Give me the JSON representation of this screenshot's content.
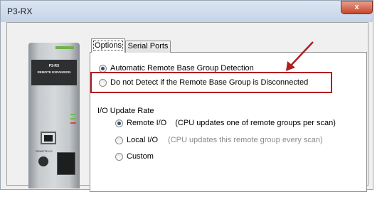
{
  "window": {
    "title": "P3-RX",
    "close_glyph": "x"
  },
  "device": {
    "model": "P3-RX",
    "description": "REMOTE EXPANSION",
    "port_label": "REMOTE I/O"
  },
  "tabs": [
    {
      "label": "Options",
      "active": true
    },
    {
      "label": "Serial Ports",
      "active": false
    }
  ],
  "options": {
    "detection": [
      {
        "label": "Automatic Remote Base Group Detection",
        "checked": true
      },
      {
        "label": "Do not Detect if the Remote Base Group is Disconnected",
        "checked": false
      }
    ],
    "io_update": {
      "label": "I/O Update Rate",
      "choices": [
        {
          "label": "Remote I/O",
          "note": "(CPU updates one of remote groups per scan)",
          "checked": true
        },
        {
          "label": "Local I/O",
          "note": "(CPU updates this remote group every scan)",
          "checked": false
        },
        {
          "label": "Custom",
          "note": "",
          "checked": false
        }
      ]
    }
  },
  "annotation": {
    "color": "#b11e22"
  }
}
